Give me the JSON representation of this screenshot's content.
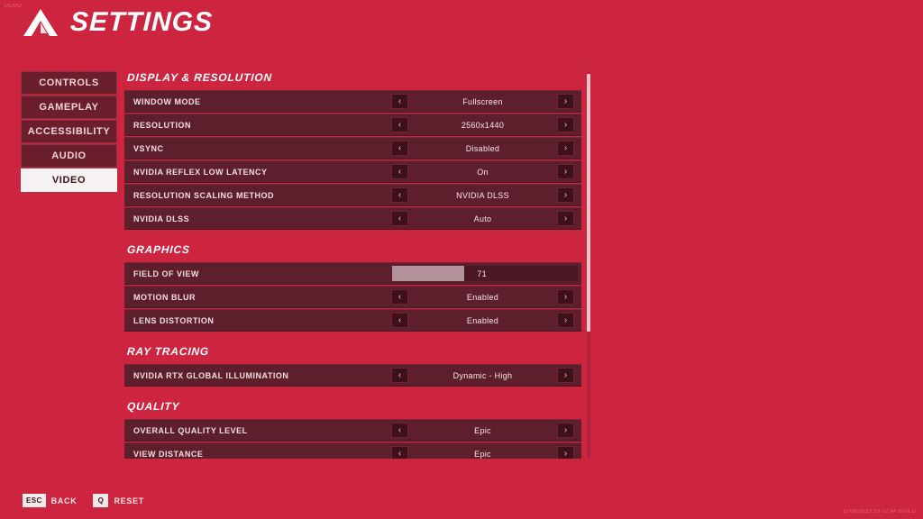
{
  "watermark": {
    "top_left": "DEMO",
    "bottom_right": "11/06/2023 19:02:44  BUILD"
  },
  "header": {
    "logo_icon": "mountain-chevron-logo-icon",
    "title": "SETTINGS"
  },
  "sidebar": {
    "items": [
      {
        "label": "CONTROLS",
        "active": false
      },
      {
        "label": "GAMEPLAY",
        "active": false
      },
      {
        "label": "ACCESSIBILITY",
        "active": false
      },
      {
        "label": "AUDIO",
        "active": false
      },
      {
        "label": "VIDEO",
        "active": true
      }
    ]
  },
  "icons": {
    "arrow_left": "‹",
    "arrow_right": "›",
    "arrow_left_name": "chevron-left-icon",
    "arrow_right_name": "chevron-right-icon"
  },
  "sections": [
    {
      "title": "DISPLAY & RESOLUTION",
      "rows": [
        {
          "type": "stepper",
          "label": "WINDOW MODE",
          "value": "Fullscreen"
        },
        {
          "type": "stepper",
          "label": "RESOLUTION",
          "value": "2560x1440"
        },
        {
          "type": "stepper",
          "label": "VSYNC",
          "value": "Disabled"
        },
        {
          "type": "stepper",
          "label": "NVIDIA REFLEX LOW LATENCY",
          "value": "On"
        },
        {
          "type": "stepper",
          "label": "RESOLUTION SCALING METHOD",
          "value": "NVIDIA DLSS"
        },
        {
          "type": "stepper",
          "label": "NVIDIA DLSS",
          "value": "Auto"
        }
      ]
    },
    {
      "title": "GRAPHICS",
      "rows": [
        {
          "type": "slider",
          "label": "FIELD OF VIEW",
          "value": "71",
          "fill_percent": 39
        },
        {
          "type": "stepper",
          "label": "MOTION BLUR",
          "value": "Enabled"
        },
        {
          "type": "stepper",
          "label": "LENS DISTORTION",
          "value": "Enabled"
        }
      ]
    },
    {
      "title": "RAY TRACING",
      "rows": [
        {
          "type": "stepper",
          "label": "NVIDIA RTX GLOBAL ILLUMINATION",
          "value": "Dynamic - High"
        }
      ]
    },
    {
      "title": "QUALITY",
      "rows": [
        {
          "type": "stepper",
          "label": "OVERALL QUALITY LEVEL",
          "value": "Epic"
        },
        {
          "type": "stepper",
          "label": "VIEW DISTANCE",
          "value": "Epic"
        }
      ]
    }
  ],
  "footer": {
    "hints": [
      {
        "key": "ESC",
        "label": "BACK"
      },
      {
        "key": "Q",
        "label": "RESET"
      }
    ]
  },
  "colors": {
    "background": "#cd243f",
    "row": "#5e1f2c",
    "row_dark": "#4a1723",
    "accent_light": "#f3c7cf",
    "slider_fill": "#b1929a",
    "active_tab": "#f7f2f2"
  }
}
